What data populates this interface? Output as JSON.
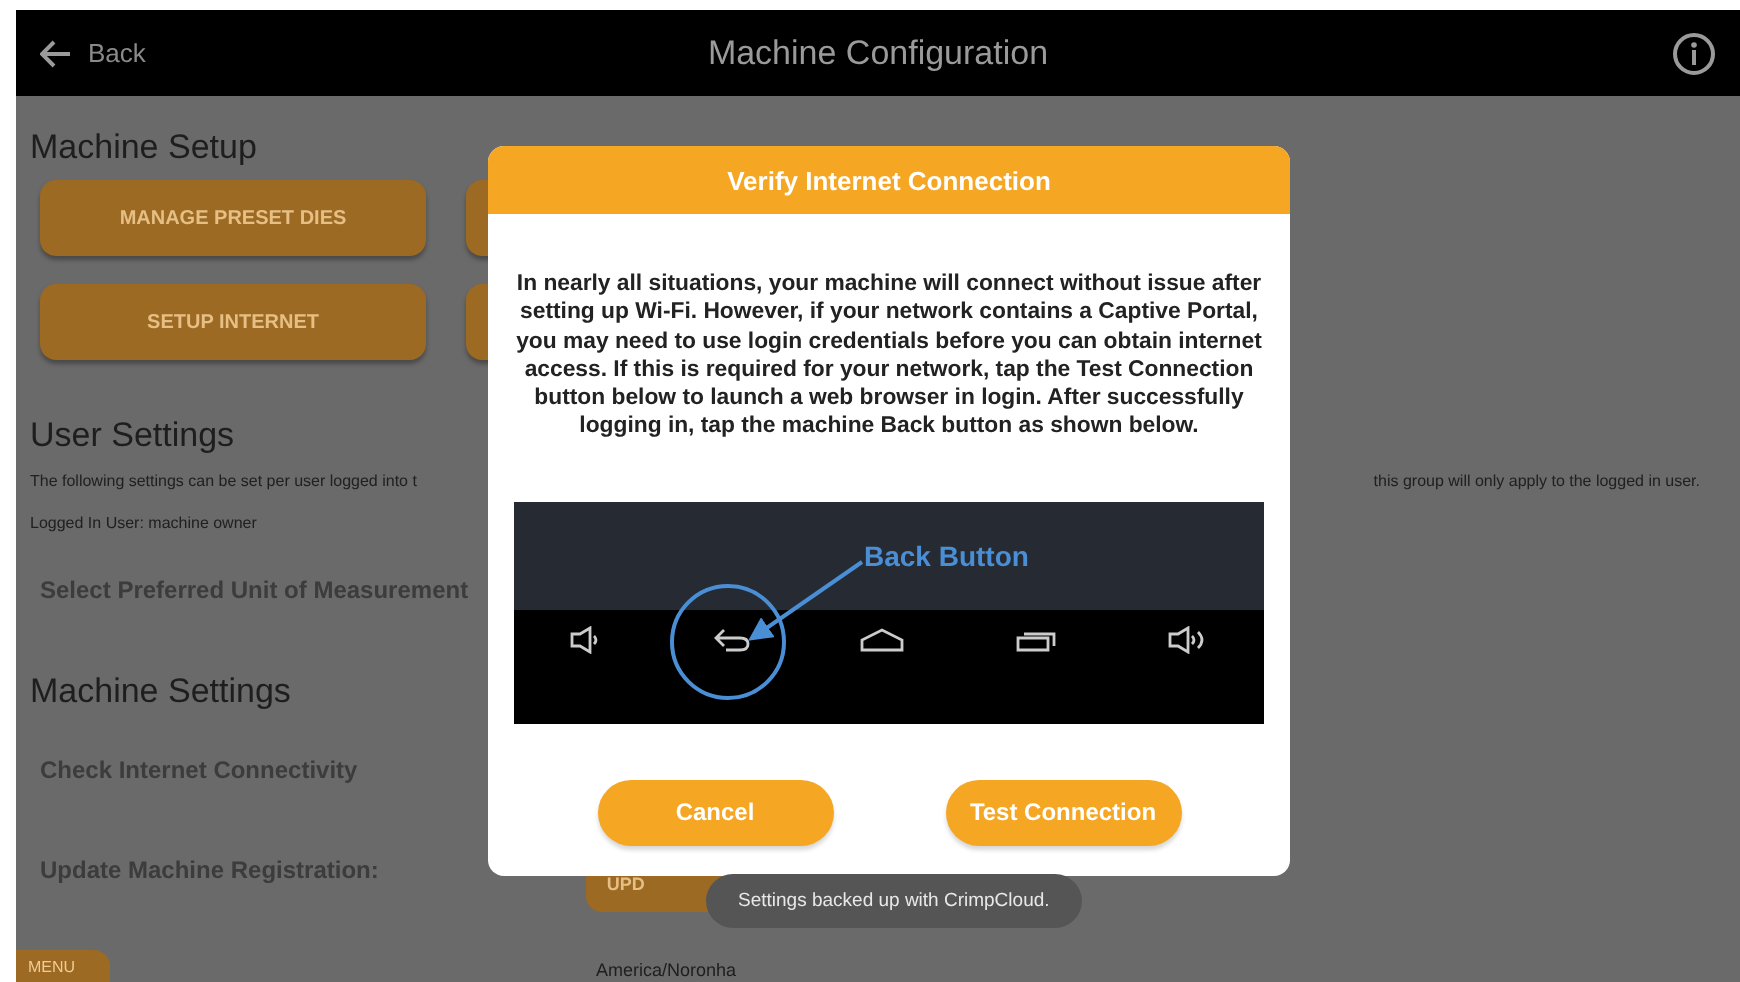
{
  "top_bar": {
    "back_label": "Back",
    "title": "Machine Configuration"
  },
  "machine_setup": {
    "heading": "Machine Setup",
    "buttons": [
      {
        "label": "MANAGE PRESET DIES"
      },
      {
        "label": "SETUP INTERNET"
      }
    ]
  },
  "user_settings": {
    "heading": "User Settings",
    "description_start": "The following settings can be set per user logged into t",
    "description_end": "this group will only apply to the logged in user.",
    "logged_in_user": "Logged In User: machine owner",
    "unit_label": "Select Preferred Unit of Measurement"
  },
  "machine_settings": {
    "heading": "Machine Settings",
    "connectivity_label": "Check Internet Connectivity",
    "registration_label": "Update Machine Registration:",
    "registration_button": "UPD",
    "timezone": "America/Noronha"
  },
  "menu_tab": "MENU",
  "dialog": {
    "title": "Verify Internet Connection",
    "message": "In nearly all situations, your machine will connect without issue after setting up Wi-Fi. However, if your network contains a Captive Portal, you may need to use login credentials before you can obtain internet access. If this is required for your network, tap the Test Connection button below to launch a web browser in login. After successfully logging in, tap the machine Back button as shown below.",
    "callout": "Back Button",
    "buttons": [
      "Cancel",
      "Test Connection"
    ]
  },
  "toast": "Settings backed up with CrimpCloud."
}
